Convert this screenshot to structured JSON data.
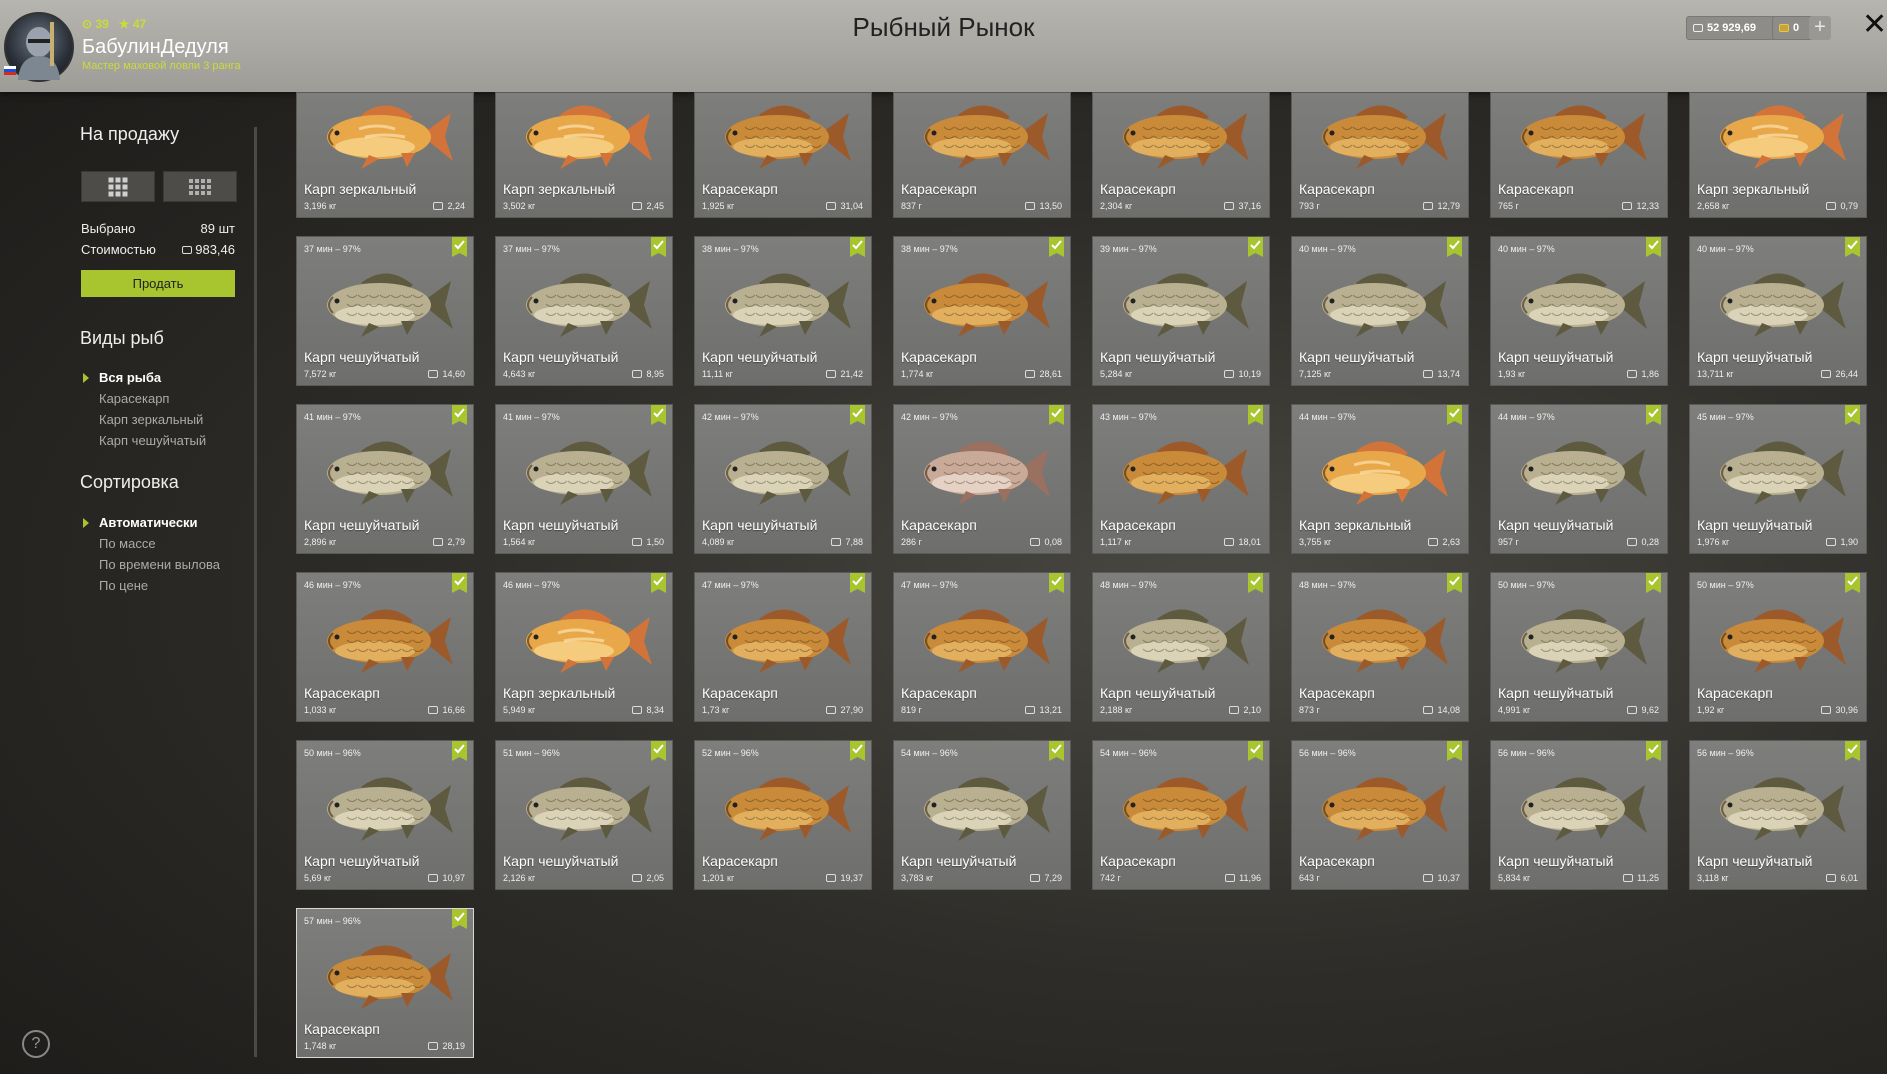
{
  "header": {
    "title": "Рыбный Рынок",
    "level": "39",
    "stars": "47",
    "username": "БабулинДедуля",
    "rank": "Мастер маховой ловли 3 ранга",
    "silver": "52 929,69",
    "gold": "0",
    "plus": "+",
    "close": "✕",
    "icons": [
      "avatar",
      "flag-ru-icon",
      "level-icon",
      "star-icon",
      "silver-coin-icon",
      "gold-coin-icon",
      "plus-icon",
      "close-icon"
    ]
  },
  "sidebar": {
    "sale_heading": "На продажу",
    "selected_label": "Выбрано",
    "selected_value": "89 шт",
    "cost_label": "Стоимостью",
    "cost_value": "983,46",
    "sell_button": "Продать",
    "species_heading": "Виды рыб",
    "species": [
      "Вся рыба",
      "Карасекарп",
      "Карп зеркальный",
      "Карп чешуйчатый"
    ],
    "sort_heading": "Сортировка",
    "sort": [
      "Автоматически",
      "По массе",
      "По времени вылова",
      "По цене"
    ],
    "help": "?"
  },
  "colors": {
    "accent": "#a8c42e",
    "header": "#a9a7a2",
    "card": "#777775"
  },
  "fish": [
    {
      "time": "",
      "name": "Карп зеркальный",
      "weight": "3,196 кг",
      "price": "2,24",
      "kind": "mirror"
    },
    {
      "time": "",
      "name": "Карп зеркальный",
      "weight": "3,502 кг",
      "price": "2,45",
      "kind": "mirror"
    },
    {
      "time": "",
      "name": "Карасекарп",
      "weight": "1,925 кг",
      "price": "31,04",
      "kind": "crucian"
    },
    {
      "time": "",
      "name": "Карасекарп",
      "weight": "837 г",
      "price": "13,50",
      "kind": "crucian"
    },
    {
      "time": "",
      "name": "Карасекарп",
      "weight": "2,304 кг",
      "price": "37,16",
      "kind": "crucian"
    },
    {
      "time": "",
      "name": "Карасекарп",
      "weight": "793 г",
      "price": "12,79",
      "kind": "crucian"
    },
    {
      "time": "",
      "name": "Карасекарп",
      "weight": "765 г",
      "price": "12,33",
      "kind": "crucian"
    },
    {
      "time": "",
      "name": "Карп зеркальный",
      "weight": "2,658 кг",
      "price": "0,79",
      "kind": "mirror"
    },
    {
      "time": "37 мин – 97%",
      "name": "Карп чешуйчатый",
      "weight": "7,572 кг",
      "price": "14,60",
      "kind": "scaly"
    },
    {
      "time": "37 мин – 97%",
      "name": "Карп чешуйчатый",
      "weight": "4,643 кг",
      "price": "8,95",
      "kind": "scaly"
    },
    {
      "time": "38 мин – 97%",
      "name": "Карп чешуйчатый",
      "weight": "11,11 кг",
      "price": "21,42",
      "kind": "scaly"
    },
    {
      "time": "38 мин – 97%",
      "name": "Карасекарп",
      "weight": "1,774 кг",
      "price": "28,61",
      "kind": "crucian"
    },
    {
      "time": "39 мин – 97%",
      "name": "Карп чешуйчатый",
      "weight": "5,284 кг",
      "price": "10,19",
      "kind": "scaly"
    },
    {
      "time": "40 мин – 97%",
      "name": "Карп чешуйчатый",
      "weight": "7,125 кг",
      "price": "13,74",
      "kind": "scaly"
    },
    {
      "time": "40 мин – 97%",
      "name": "Карп чешуйчатый",
      "weight": "1,93 кг",
      "price": "1,86",
      "kind": "scaly"
    },
    {
      "time": "40 мин – 97%",
      "name": "Карп чешуйчатый",
      "weight": "13,711 кг",
      "price": "26,44",
      "kind": "scaly"
    },
    {
      "time": "41 мин – 97%",
      "name": "Карп чешуйчатый",
      "weight": "2,896 кг",
      "price": "2,79",
      "kind": "scaly"
    },
    {
      "time": "41 мин – 97%",
      "name": "Карп чешуйчатый",
      "weight": "1,564 кг",
      "price": "1,50",
      "kind": "scaly"
    },
    {
      "time": "42 мин – 97%",
      "name": "Карп чешуйчатый",
      "weight": "4,089 кг",
      "price": "7,88",
      "kind": "scaly"
    },
    {
      "time": "42 мин – 97%",
      "name": "Карасекарп",
      "weight": "286 г",
      "price": "0,08",
      "kind": "pale"
    },
    {
      "time": "43 мин – 97%",
      "name": "Карасекарп",
      "weight": "1,117 кг",
      "price": "18,01",
      "kind": "crucian"
    },
    {
      "time": "44 мин – 97%",
      "name": "Карп зеркальный",
      "weight": "3,755 кг",
      "price": "2,63",
      "kind": "mirror"
    },
    {
      "time": "44 мин – 97%",
      "name": "Карп чешуйчатый",
      "weight": "957 г",
      "price": "0,28",
      "kind": "scaly"
    },
    {
      "time": "45 мин – 97%",
      "name": "Карп чешуйчатый",
      "weight": "1,976 кг",
      "price": "1,90",
      "kind": "scaly"
    },
    {
      "time": "46 мин – 97%",
      "name": "Карасекарп",
      "weight": "1,033 кг",
      "price": "16,66",
      "kind": "crucian"
    },
    {
      "time": "46 мин – 97%",
      "name": "Карп зеркальный",
      "weight": "5,949 кг",
      "price": "8,34",
      "kind": "mirror"
    },
    {
      "time": "47 мин – 97%",
      "name": "Карасекарп",
      "weight": "1,73 кг",
      "price": "27,90",
      "kind": "crucian"
    },
    {
      "time": "47 мин – 97%",
      "name": "Карасекарп",
      "weight": "819 г",
      "price": "13,21",
      "kind": "crucian"
    },
    {
      "time": "48 мин – 97%",
      "name": "Карп чешуйчатый",
      "weight": "2,188 кг",
      "price": "2,10",
      "kind": "scaly"
    },
    {
      "time": "48 мин – 97%",
      "name": "Карасекарп",
      "weight": "873 г",
      "price": "14,08",
      "kind": "crucian"
    },
    {
      "time": "50 мин – 97%",
      "name": "Карп чешуйчатый",
      "weight": "4,991 кг",
      "price": "9,62",
      "kind": "scaly"
    },
    {
      "time": "50 мин – 97%",
      "name": "Карасекарп",
      "weight": "1,92 кг",
      "price": "30,96",
      "kind": "crucian"
    },
    {
      "time": "50 мин – 96%",
      "name": "Карп чешуйчатый",
      "weight": "5,69 кг",
      "price": "10,97",
      "kind": "scaly"
    },
    {
      "time": "51 мин – 96%",
      "name": "Карп чешуйчатый",
      "weight": "2,126 кг",
      "price": "2,05",
      "kind": "scaly"
    },
    {
      "time": "52 мин – 96%",
      "name": "Карасекарп",
      "weight": "1,201 кг",
      "price": "19,37",
      "kind": "crucian"
    },
    {
      "time": "54 мин – 96%",
      "name": "Карп чешуйчатый",
      "weight": "3,783 кг",
      "price": "7,29",
      "kind": "scaly"
    },
    {
      "time": "54 мин – 96%",
      "name": "Карасекарп",
      "weight": "742 г",
      "price": "11,96",
      "kind": "crucian"
    },
    {
      "time": "56 мин – 96%",
      "name": "Карасекарп",
      "weight": "643 г",
      "price": "10,37",
      "kind": "crucian"
    },
    {
      "time": "56 мин – 96%",
      "name": "Карп чешуйчатый",
      "weight": "5,834 кг",
      "price": "11,25",
      "kind": "scaly"
    },
    {
      "time": "56 мин – 96%",
      "name": "Карп чешуйчатый",
      "weight": "3,118 кг",
      "price": "6,01",
      "kind": "scaly"
    },
    {
      "time": "57 мин – 96%",
      "name": "Карасекарп",
      "weight": "1,748 кг",
      "price": "28,19",
      "kind": "crucian"
    }
  ]
}
